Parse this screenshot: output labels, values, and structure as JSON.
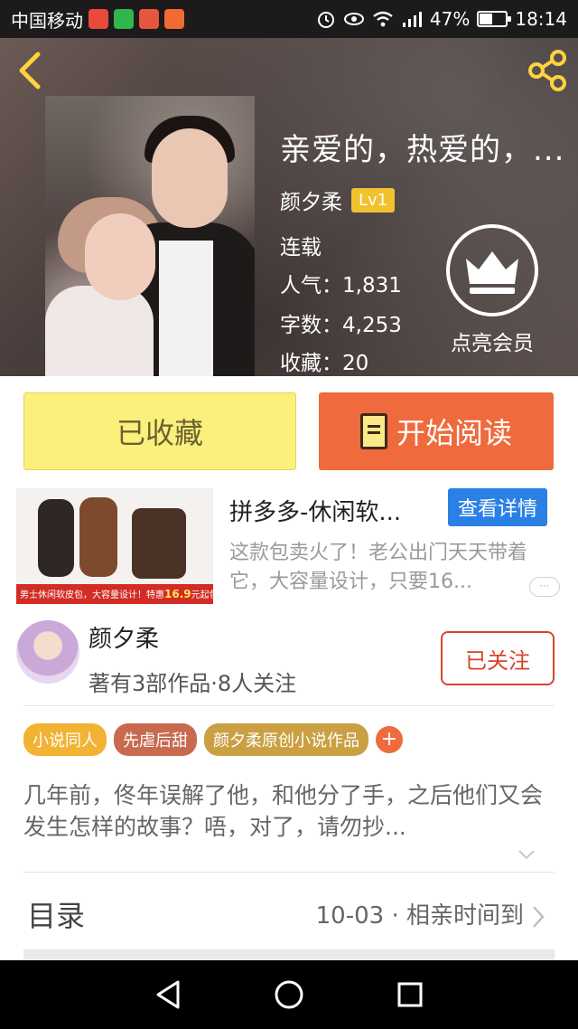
{
  "statusbar": {
    "carrier": "中国移动",
    "battery_percent": "47%",
    "battery_level": 0.47,
    "time": "18:14",
    "icons": [
      "alarm-icon",
      "eye-icon",
      "wifi-icon",
      "signal-icon",
      "battery-icon"
    ],
    "app_icons": [
      "taobao-icon",
      "iqiyi-icon",
      "app-icon",
      "video-icon"
    ]
  },
  "book": {
    "title": "亲爱的，热爱的，...",
    "author": "颜夕柔",
    "level": "Lv1",
    "status": "连载",
    "popularity": "人气：1,831",
    "words": "字数：4,253",
    "favorites": "收藏：20",
    "vip_label": "点亮会员"
  },
  "actions": {
    "favorite_label": "已收藏",
    "read_label": "开始阅读"
  },
  "ad": {
    "title": "拼多多-休闲软...",
    "button": "查看详情",
    "desc": "这款包卖火了！老公出门天天带着它，大容量设计，只要16...",
    "strip_text": "男士休闲软皮包，大容量设计！特惠",
    "strip_price": "16.9",
    "strip_tail": "元起包邮！",
    "more": "···"
  },
  "author_card": {
    "name": "颜夕柔",
    "stats": "著有3部作品·8人关注",
    "follow_label": "已关注"
  },
  "tags": [
    {
      "label": "小说同人",
      "color": "#f2b233"
    },
    {
      "label": "先虐后甜",
      "color": "#c86a4e"
    },
    {
      "label": "颜夕柔原创小说作品",
      "color": "#caa043"
    }
  ],
  "tag_add": "+",
  "description": "几年前，佟年误解了他，和他分了手，之后他们又会发生怎样的故事？唔，对了，请勿抄...",
  "toc": {
    "label": "目录",
    "latest": "10-03 · 相亲时间到"
  },
  "colors": {
    "accent_orange": "#ef6a3c",
    "fav_yellow": "#fbf07c",
    "ad_blue": "#2b80e6",
    "follow_red": "#d8432c",
    "back_yellow": "#ffd33d"
  }
}
